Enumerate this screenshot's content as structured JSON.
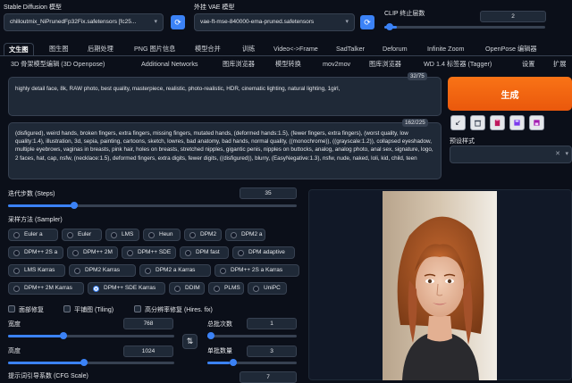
{
  "header": {
    "sd_model_label": "Stable Diffusion 模型",
    "sd_model_value": "chilloutmix_NiPrunedFp32Fix.safetensors [fc25...",
    "vae_label": "外挂 VAE 模型",
    "vae_value": "vae-ft-mse-840000-ema-pruned.safetensors",
    "clip_label": "CLIP 终止层数",
    "clip_value": "2",
    "clip_fraction": 0.08
  },
  "tabs_row1": [
    "文生图",
    "图生图",
    "后期处理",
    "PNG 图片信息",
    "模型合并",
    "训练",
    "Video<->Frame",
    "SadTalker",
    "Deforum",
    "Infinite Zoom",
    "OpenPose 编辑器"
  ],
  "tabs_row2": [
    "3D 骨架模型编辑 (3D Openpose)",
    "Additional Networks",
    "图库浏览器",
    "模型转换",
    "mov2mov",
    "图库浏览器",
    "WD 1.4 标签器 (Tagger)",
    "设置",
    "扩展"
  ],
  "prompt": {
    "text": "highly detail face, 8k, RAW photo, best quality, masterpiece, realistic, photo-realistic, HDR, cinematic lighting, natural lighting, 1girl,",
    "counter": "32/75"
  },
  "negative_prompt": {
    "text": "(disfigured), weird hands, broken fingers, extra fingers, missing fingers, mutated hands, (deformed hands:1.5), (fewer fingers, extra fingers), (worst quality, low quality:1.4), illustration, 3d, sepia, painting, cartoons, sketch, lowres, bad anatomy, bad hands, normal quality, ((monochrome)), ((grayscale:1.2)), collapsed eyeshadow, multiple eyebrows, vaginas in breasts, pink hair, holes on breasts, stretched nipples, gigantic penis, nipples on buttocks, analog, analog photo, anal sex, signature, logo, 2 faces, hat, cap, nsfw, (necklace:1.5), deformed fingers, extra digits, fewer digits, ((disfigured)), blurry, (EasyNegative:1.3), nsfw, nude, naked, loli, kid, child, teen",
    "counter": "162/225"
  },
  "generate_label": "生成",
  "tool_buttons": [
    "arrow-icon",
    "trash-icon",
    "paste-icon",
    "style-save-icon",
    "style-apply-icon"
  ],
  "styles": {
    "label": "预设样式",
    "value": ""
  },
  "steps": {
    "label": "迭代步数 (Steps)",
    "value": "35",
    "fraction": 0.23
  },
  "sampler": {
    "label": "采样方法 (Sampler)",
    "options": [
      [
        "Euler a",
        "Euler",
        "LMS",
        "Heun",
        "DPM2",
        "DPM2 a"
      ],
      [
        "DPM++ 2S a",
        "DPM++ 2M",
        "DPM++ SDE",
        "DPM fast",
        "DPM adaptive"
      ],
      [
        "LMS Karras",
        "DPM2 Karras",
        "DPM2 a Karras",
        "DPM++ 2S a Karras"
      ],
      [
        "DPM++ 2M Karras",
        "DPM++ SDE Karras",
        "DDIM",
        "PLMS",
        "UniPC"
      ]
    ],
    "selected": "DPM++ SDE Karras"
  },
  "checkboxes": [
    "面部修复",
    "平铺图 (Tiling)",
    "高分辨率修复 (Hires. fix)"
  ],
  "width": {
    "label": "宽度",
    "value": "768",
    "fraction": 0.33
  },
  "height": {
    "label": "高度",
    "value": "1024",
    "fraction": 0.45
  },
  "batch_count": {
    "label": "总批次数",
    "value": "1",
    "fraction": 0.0
  },
  "batch_size": {
    "label": "单批数量",
    "value": "3",
    "fraction": 0.25
  },
  "cfg": {
    "label": "提示词引导系数 (CFG Scale)",
    "value": "7"
  },
  "swap_icon": "⇅",
  "colors": {
    "accent": "#3b82f6",
    "generate": "#ea580c",
    "bg": "#0b0f19"
  }
}
